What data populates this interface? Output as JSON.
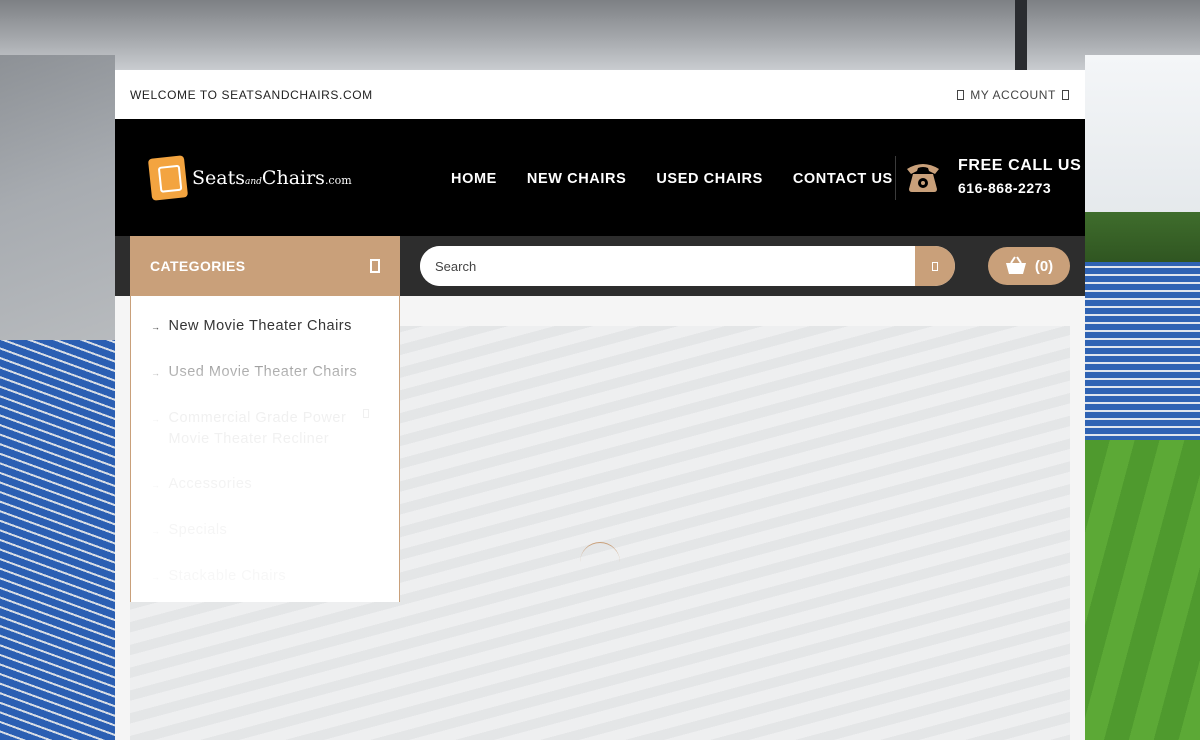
{
  "topbar": {
    "welcome": "WELCOME TO SEATSANDCHAIRS.COM",
    "account_label": "MY ACCOUNT"
  },
  "header": {
    "logo": {
      "brand": "Seats",
      "and": "and",
      "brand2": "Chairs",
      "tld": ".com"
    },
    "nav": [
      "HOME",
      "NEW CHAIRS",
      "USED CHAIRS",
      "CONTACT US"
    ],
    "call_title": "FREE CALL US",
    "call_number": "616-868-2273"
  },
  "strip": {
    "categories_label": "CATEGORIES",
    "search_placeholder": "Search",
    "cart_count": "(0)"
  },
  "categories": [
    {
      "label": "New Movie Theater Chairs",
      "has_sub": false
    },
    {
      "label": "Used Movie Theater Chairs",
      "has_sub": false
    },
    {
      "label": "Commercial Grade Power Movie Theater Recliner",
      "has_sub": true
    },
    {
      "label": "Accessories",
      "has_sub": false
    },
    {
      "label": "Specials",
      "has_sub": false
    },
    {
      "label": "Stackable Chairs",
      "has_sub": false
    }
  ],
  "colors": {
    "accent": "#c9a07a",
    "header_bg": "#000000",
    "strip_bg": "#2d2d2d"
  }
}
